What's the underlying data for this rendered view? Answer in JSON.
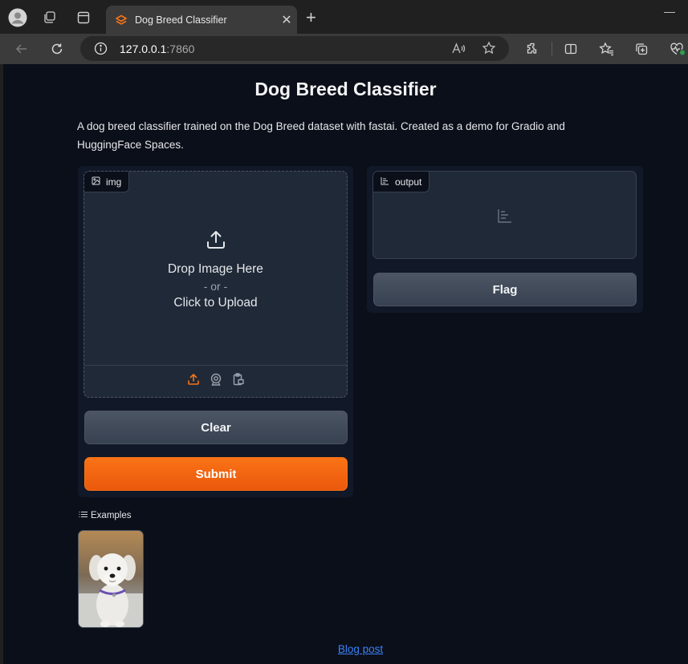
{
  "browser": {
    "tab_title": "Dog Breed Classifier",
    "url_host": "127.0.0.1",
    "url_port": ":7860",
    "tab_close": "✕",
    "new_tab": "+",
    "minimize": "—"
  },
  "app": {
    "title": "Dog Breed Classifier",
    "description": "A dog breed classifier trained on the Dog Breed dataset with fastai. Created as a demo for Gradio and HuggingFace Spaces.",
    "input": {
      "label": "img",
      "drop_text": "Drop Image Here",
      "or_text": "- or -",
      "click_text": "Click to Upload"
    },
    "output": {
      "label": "output"
    },
    "buttons": {
      "clear": "Clear",
      "submit": "Submit",
      "flag": "Flag"
    },
    "examples": {
      "label": "Examples"
    },
    "footer_link": "Blog post"
  },
  "colors": {
    "accent": "#f97316",
    "background": "#0b0f19",
    "panel": "#111827",
    "link": "#3b82f6"
  }
}
